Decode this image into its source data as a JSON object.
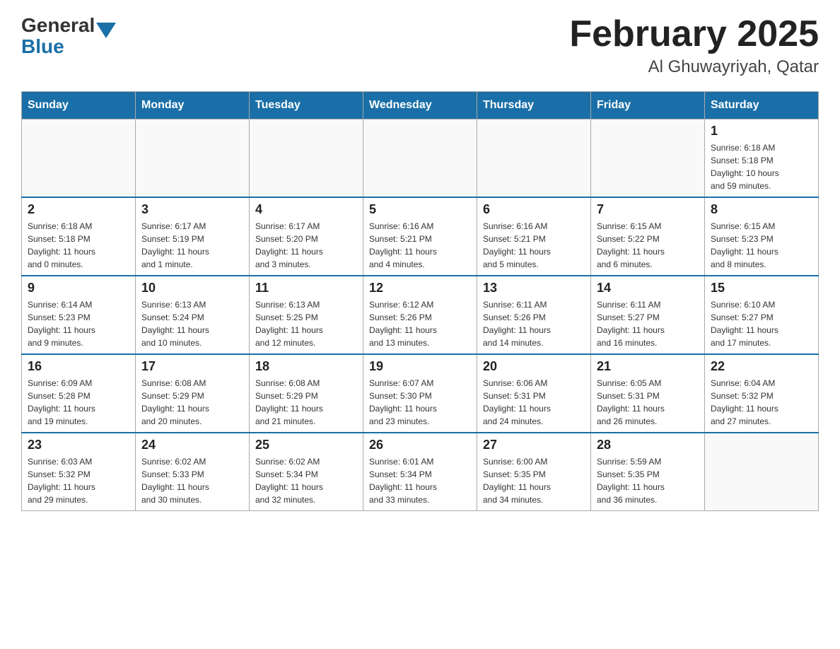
{
  "header": {
    "logo": {
      "general": "General",
      "blue": "Blue"
    },
    "title": "February 2025",
    "subtitle": "Al Ghuwayriyah, Qatar"
  },
  "days_of_week": [
    "Sunday",
    "Monday",
    "Tuesday",
    "Wednesday",
    "Thursday",
    "Friday",
    "Saturday"
  ],
  "weeks": [
    [
      {
        "day": "",
        "info": ""
      },
      {
        "day": "",
        "info": ""
      },
      {
        "day": "",
        "info": ""
      },
      {
        "day": "",
        "info": ""
      },
      {
        "day": "",
        "info": ""
      },
      {
        "day": "",
        "info": ""
      },
      {
        "day": "1",
        "info": "Sunrise: 6:18 AM\nSunset: 5:18 PM\nDaylight: 10 hours\nand 59 minutes."
      }
    ],
    [
      {
        "day": "2",
        "info": "Sunrise: 6:18 AM\nSunset: 5:18 PM\nDaylight: 11 hours\nand 0 minutes."
      },
      {
        "day": "3",
        "info": "Sunrise: 6:17 AM\nSunset: 5:19 PM\nDaylight: 11 hours\nand 1 minute."
      },
      {
        "day": "4",
        "info": "Sunrise: 6:17 AM\nSunset: 5:20 PM\nDaylight: 11 hours\nand 3 minutes."
      },
      {
        "day": "5",
        "info": "Sunrise: 6:16 AM\nSunset: 5:21 PM\nDaylight: 11 hours\nand 4 minutes."
      },
      {
        "day": "6",
        "info": "Sunrise: 6:16 AM\nSunset: 5:21 PM\nDaylight: 11 hours\nand 5 minutes."
      },
      {
        "day": "7",
        "info": "Sunrise: 6:15 AM\nSunset: 5:22 PM\nDaylight: 11 hours\nand 6 minutes."
      },
      {
        "day": "8",
        "info": "Sunrise: 6:15 AM\nSunset: 5:23 PM\nDaylight: 11 hours\nand 8 minutes."
      }
    ],
    [
      {
        "day": "9",
        "info": "Sunrise: 6:14 AM\nSunset: 5:23 PM\nDaylight: 11 hours\nand 9 minutes."
      },
      {
        "day": "10",
        "info": "Sunrise: 6:13 AM\nSunset: 5:24 PM\nDaylight: 11 hours\nand 10 minutes."
      },
      {
        "day": "11",
        "info": "Sunrise: 6:13 AM\nSunset: 5:25 PM\nDaylight: 11 hours\nand 12 minutes."
      },
      {
        "day": "12",
        "info": "Sunrise: 6:12 AM\nSunset: 5:26 PM\nDaylight: 11 hours\nand 13 minutes."
      },
      {
        "day": "13",
        "info": "Sunrise: 6:11 AM\nSunset: 5:26 PM\nDaylight: 11 hours\nand 14 minutes."
      },
      {
        "day": "14",
        "info": "Sunrise: 6:11 AM\nSunset: 5:27 PM\nDaylight: 11 hours\nand 16 minutes."
      },
      {
        "day": "15",
        "info": "Sunrise: 6:10 AM\nSunset: 5:27 PM\nDaylight: 11 hours\nand 17 minutes."
      }
    ],
    [
      {
        "day": "16",
        "info": "Sunrise: 6:09 AM\nSunset: 5:28 PM\nDaylight: 11 hours\nand 19 minutes."
      },
      {
        "day": "17",
        "info": "Sunrise: 6:08 AM\nSunset: 5:29 PM\nDaylight: 11 hours\nand 20 minutes."
      },
      {
        "day": "18",
        "info": "Sunrise: 6:08 AM\nSunset: 5:29 PM\nDaylight: 11 hours\nand 21 minutes."
      },
      {
        "day": "19",
        "info": "Sunrise: 6:07 AM\nSunset: 5:30 PM\nDaylight: 11 hours\nand 23 minutes."
      },
      {
        "day": "20",
        "info": "Sunrise: 6:06 AM\nSunset: 5:31 PM\nDaylight: 11 hours\nand 24 minutes."
      },
      {
        "day": "21",
        "info": "Sunrise: 6:05 AM\nSunset: 5:31 PM\nDaylight: 11 hours\nand 26 minutes."
      },
      {
        "day": "22",
        "info": "Sunrise: 6:04 AM\nSunset: 5:32 PM\nDaylight: 11 hours\nand 27 minutes."
      }
    ],
    [
      {
        "day": "23",
        "info": "Sunrise: 6:03 AM\nSunset: 5:32 PM\nDaylight: 11 hours\nand 29 minutes."
      },
      {
        "day": "24",
        "info": "Sunrise: 6:02 AM\nSunset: 5:33 PM\nDaylight: 11 hours\nand 30 minutes."
      },
      {
        "day": "25",
        "info": "Sunrise: 6:02 AM\nSunset: 5:34 PM\nDaylight: 11 hours\nand 32 minutes."
      },
      {
        "day": "26",
        "info": "Sunrise: 6:01 AM\nSunset: 5:34 PM\nDaylight: 11 hours\nand 33 minutes."
      },
      {
        "day": "27",
        "info": "Sunrise: 6:00 AM\nSunset: 5:35 PM\nDaylight: 11 hours\nand 34 minutes."
      },
      {
        "day": "28",
        "info": "Sunrise: 5:59 AM\nSunset: 5:35 PM\nDaylight: 11 hours\nand 36 minutes."
      },
      {
        "day": "",
        "info": ""
      }
    ]
  ]
}
